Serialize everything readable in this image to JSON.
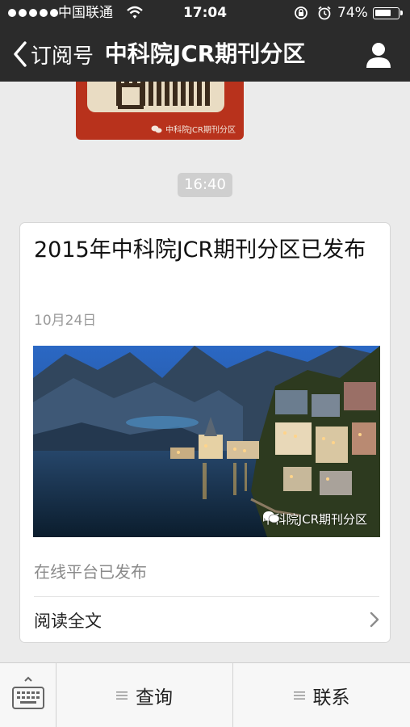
{
  "status_bar": {
    "carrier": "中国联通",
    "time": "17:04",
    "battery_percent": "74%",
    "battery_level": 0.74,
    "icons": [
      "signal-dots-icon",
      "wifi-icon",
      "rotation-lock-icon",
      "alarm-icon",
      "battery-icon"
    ]
  },
  "nav": {
    "back_label": "订阅号",
    "title": "中科院JCR期刊分区",
    "profile_icon": "person-icon"
  },
  "previous_message": {
    "image_caption": "中科院JCR期刊分区"
  },
  "timestamp": "16:40",
  "article": {
    "title": "2015年中科院JCR期刊分区已发布",
    "date": "10月24日",
    "cover_caption": "中科院JCR期刊分区",
    "summary": "在线平台已发布",
    "read_more_label": "阅读全文"
  },
  "bottom_menu": {
    "keyboard_icon": "keyboard-icon",
    "items": [
      {
        "label": "查询",
        "icon": "menu-lines-icon"
      },
      {
        "label": "联系",
        "icon": "menu-lines-icon"
      }
    ]
  },
  "colors": {
    "topbar": "#2b2b2b",
    "background": "#ebebeb",
    "qr_card": "#b8321c"
  }
}
